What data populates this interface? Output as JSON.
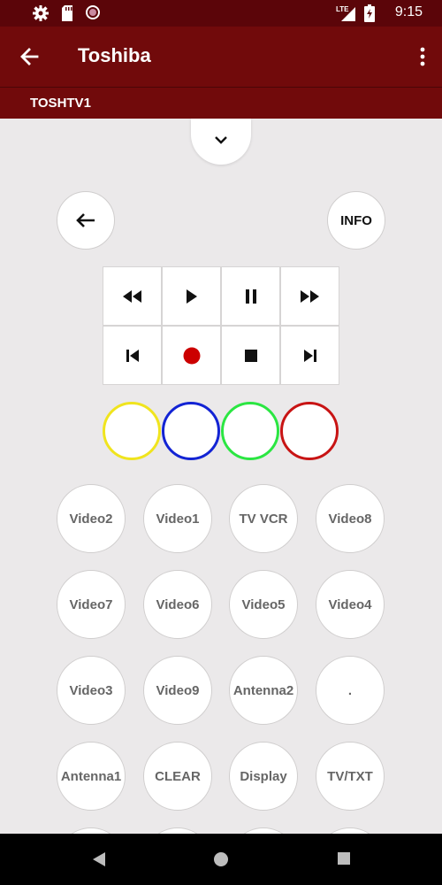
{
  "status_bar": {
    "icons": [
      "settings-icon",
      "sd-card-icon",
      "circle-icon",
      "lte-signal-icon",
      "battery-icon"
    ],
    "network": "LTE",
    "time": "9:15"
  },
  "app_bar": {
    "title": "Toshiba",
    "back_icon": "arrow-left-icon",
    "menu_icon": "more-vert-icon"
  },
  "device_bar": {
    "device_name": "TOSHTV1"
  },
  "remote": {
    "collapse_icon": "chevron-down-icon",
    "back_icon": "arrow-left-icon",
    "info_label": "INFO",
    "transport": [
      [
        "rewind-icon",
        "play-icon",
        "pause-icon",
        "fast-forward-icon"
      ],
      [
        "skip-previous-icon",
        "record-icon",
        "stop-icon",
        "skip-next-icon"
      ]
    ],
    "color_buttons": [
      {
        "name": "yellow",
        "color": "#f0e41e"
      },
      {
        "name": "blue",
        "color": "#1324d4"
      },
      {
        "name": "green",
        "color": "#2be642"
      },
      {
        "name": "red",
        "color": "#c81414"
      }
    ],
    "record_color": "#cc0000",
    "keys": [
      [
        "Video2",
        "Video1",
        "TV VCR",
        "Video8"
      ],
      [
        "Video7",
        "Video6",
        "Video5",
        "Video4"
      ],
      [
        "Video3",
        "Video9",
        "Antenna2",
        "."
      ],
      [
        "Antenna1",
        "CLEAR",
        "Display",
        "TV/TXT"
      ]
    ]
  },
  "colors": {
    "status_bar": "#5b0509",
    "app_bar": "#710a0b",
    "background": "#ebe9ea"
  },
  "nav_bar": {
    "items": [
      "back-triangle-icon",
      "home-circle-icon",
      "recents-square-icon"
    ]
  }
}
